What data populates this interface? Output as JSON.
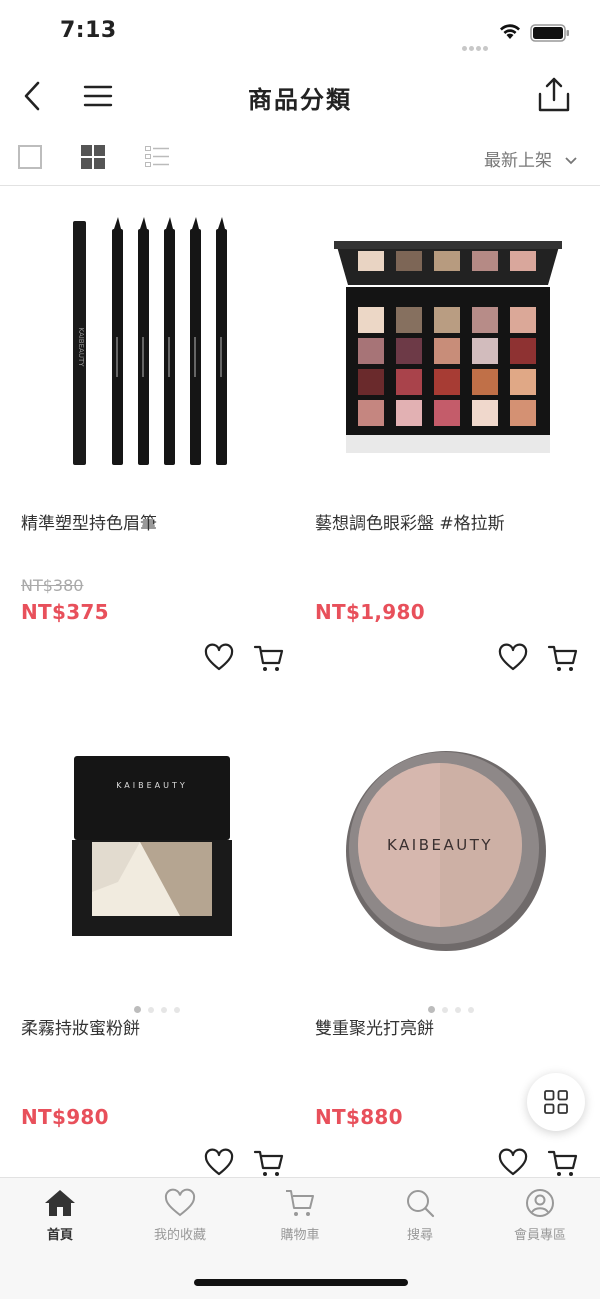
{
  "status": {
    "time": "7:13"
  },
  "header": {
    "title": "商品分類"
  },
  "toolbar": {
    "sort_label": "最新上架"
  },
  "products": [
    {
      "name": "精準塑型持色眉筆",
      "original_price": "NT$380",
      "price": "NT$375"
    },
    {
      "name": "藝想調色眼彩盤 #格拉斯",
      "original_price": "",
      "price": "NT$1,980"
    },
    {
      "name": "柔霧持妝蜜粉餅",
      "original_price": "",
      "price": "NT$980"
    },
    {
      "name": "雙重聚光打亮餅",
      "original_price": "",
      "price": "NT$880"
    }
  ],
  "brand_text": "KAIBEAUTY",
  "tabs": [
    {
      "label": "首頁",
      "icon": "home-icon"
    },
    {
      "label": "我的收藏",
      "icon": "heart-icon"
    },
    {
      "label": "購物車",
      "icon": "cart-icon"
    },
    {
      "label": "搜尋",
      "icon": "search-icon"
    },
    {
      "label": "會員專區",
      "icon": "user-icon"
    }
  ],
  "colors": {
    "price": "#e8505b",
    "active_tab": "#333333",
    "inactive_tab": "#999999"
  }
}
